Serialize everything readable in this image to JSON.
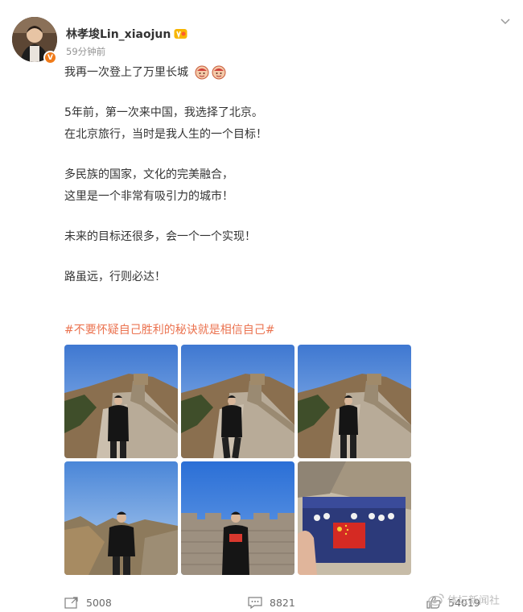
{
  "author": {
    "name": "林孝埈Lin_xiaojun",
    "time": "59分钟前",
    "badge": "V"
  },
  "post": {
    "lines": [
      "我再一次登上了万里长城",
      "5年前，第一次来中国，我选择了北京。",
      "在北京旅行，当时是我人生的一个目标！",
      "多民族的国家，文化的完美融合，",
      "这里是一个非常有吸引力的城市！",
      "未来的目标还很多，会一个一个实现！",
      "路虽远，行则必达！"
    ],
    "hashtag": "#不要怀疑自己胜利的秘诀就是相信自己#"
  },
  "actions": {
    "repost": "5008",
    "comment": "8821",
    "like": "54019"
  },
  "watermark": "体坛新闻社",
  "colors": {
    "hashtag": "#eb7350",
    "badge": "#f07b1a",
    "sky": "#4f86d6",
    "text": "#333333",
    "muted": "#939393"
  },
  "icons": [
    "more-icon",
    "vip-icon",
    "emoji-icon",
    "repost-icon",
    "comment-icon",
    "like-icon",
    "weibo-icon"
  ]
}
